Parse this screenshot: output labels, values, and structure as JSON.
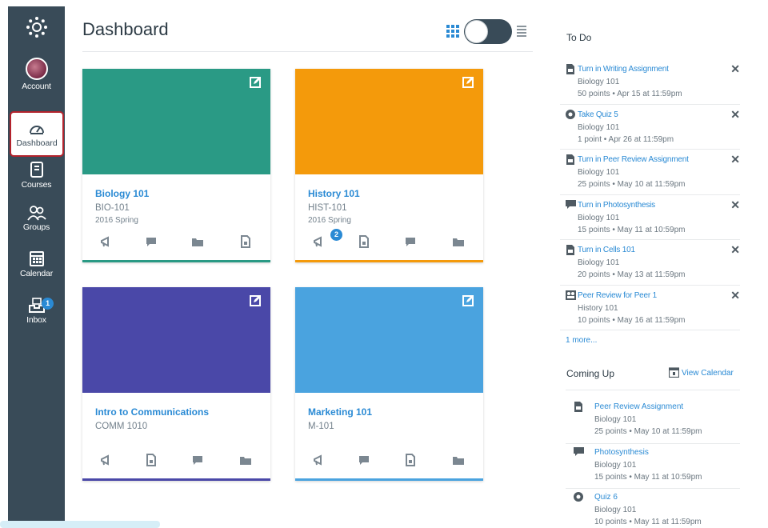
{
  "colors": {
    "nav_bg": "#394b58",
    "accent": "#2a8ad4",
    "active_border": "#b3232d"
  },
  "nav": {
    "items": [
      {
        "label": "Account",
        "icon": "avatar"
      },
      {
        "label": "Dashboard",
        "icon": "dashboard-icon",
        "active": true
      },
      {
        "label": "Courses",
        "icon": "courses-icon"
      },
      {
        "label": "Groups",
        "icon": "groups-icon"
      },
      {
        "label": "Calendar",
        "icon": "calendar-icon"
      },
      {
        "label": "Inbox",
        "icon": "inbox-icon",
        "badge": "1"
      }
    ]
  },
  "header": {
    "title": "Dashboard",
    "view_mode": "card"
  },
  "cards": [
    {
      "title": "Biology 101",
      "code": "BIO-101",
      "term": "2016 Spring",
      "color": "#2a9a85",
      "icons": [
        "announcements-icon",
        "discussions-icon",
        "files-icon",
        "assignments-icon"
      ]
    },
    {
      "title": "History 101",
      "code": "HIST-101",
      "term": "2016 Spring",
      "color": "#f49a0b",
      "badge": "2",
      "icons": [
        "announcements-icon",
        "assignments-icon",
        "discussions-icon",
        "files-icon"
      ]
    },
    {
      "title": "Intro to Communications",
      "code": "COMM 1010",
      "term": "",
      "color": "#4a48a8",
      "icons": [
        "announcements-icon",
        "assignments-icon",
        "discussions-icon",
        "files-icon"
      ]
    },
    {
      "title": "Marketing 101",
      "code": "M-101",
      "term": "",
      "color": "#4aa3df",
      "icons": [
        "announcements-icon",
        "discussions-icon",
        "assignments-icon",
        "files-icon"
      ]
    }
  ],
  "todo": {
    "heading": "To Do",
    "items": [
      {
        "title": "Turn in Writing Assignment",
        "course": "Biology 101",
        "meta": "50 points • Apr 15 at 11:59pm",
        "icon": "assignment-icon"
      },
      {
        "title": "Take Quiz 5",
        "course": "Biology 101",
        "meta": "1 point • Apr 26 at 11:59pm",
        "icon": "quiz-icon"
      },
      {
        "title": "Turn in Peer Review Assignment",
        "course": "Biology 101",
        "meta": "25 points • May 10 at 11:59pm",
        "icon": "assignment-icon"
      },
      {
        "title": "Turn in Photosynthesis",
        "course": "Biology 101",
        "meta": "15 points • May 11 at 10:59pm",
        "icon": "discussion-icon"
      },
      {
        "title": "Turn in Cells 101",
        "course": "Biology 101",
        "meta": "20 points • May 13 at 11:59pm",
        "icon": "assignment-icon"
      },
      {
        "title": "Peer Review for Peer 1",
        "course": "History 101",
        "meta": "10 points • May 16 at 11:59pm",
        "icon": "peer-review-icon"
      }
    ],
    "more": "1 more..."
  },
  "coming_up": {
    "heading": "Coming Up",
    "view_calendar": "View Calendar",
    "items": [
      {
        "title": "Peer Review Assignment",
        "course": "Biology 101",
        "meta": "25 points • May 10 at 11:59pm",
        "icon": "assignment-icon"
      },
      {
        "title": "Photosynthesis",
        "course": "Biology 101",
        "meta": "15 points • May 11 at 10:59pm",
        "icon": "discussion-icon"
      },
      {
        "title": "Quiz 6",
        "course": "Biology 101",
        "meta": "10 points • May 11 at 11:59pm",
        "icon": "quiz-icon"
      }
    ]
  }
}
